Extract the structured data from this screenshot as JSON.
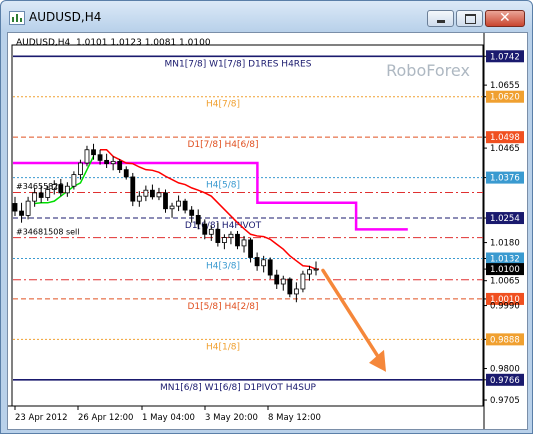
{
  "window": {
    "title": "AUDUSD,H4",
    "controls": {
      "minimize": "minimize",
      "maximize": "maximize",
      "close": "close"
    }
  },
  "header": {
    "symbol": "AUDUSD,H4",
    "ohlc": "1.0101 1.0123 1.0081 1.0100"
  },
  "watermark": "RoboForex",
  "colors": {
    "background": "#ffffff",
    "candles": "#000000",
    "trail_red": "#ff0000",
    "trail_green": "#00dd00",
    "magenta": "#ff00ff",
    "arrow": "#f5873a",
    "current_price_box": "#000000"
  },
  "chart_data": {
    "type": "candlestick",
    "x_tick_labels": [
      "23 Apr 2012",
      "26 Apr 12:00",
      "1 May 04:00",
      "3 May 20:00",
      "8 May 12:00"
    ],
    "y_range": [
      0.969,
      1.077
    ],
    "y_ticks": [
      {
        "value": 1.0742,
        "label": "1.0742",
        "style": "boxed-navy"
      },
      {
        "value": 1.0655,
        "label": "1.0655",
        "style": "plain"
      },
      {
        "value": 1.062,
        "label": "1.0620",
        "style": "boxed-orange"
      },
      {
        "value": 1.0498,
        "label": "1.0498",
        "style": "boxed-red"
      },
      {
        "value": 1.0465,
        "label": "1.0465",
        "style": "plain"
      },
      {
        "value": 1.0376,
        "label": "1.0376",
        "style": "boxed-blue"
      },
      {
        "value": 1.0254,
        "label": "1.0254",
        "style": "boxed-navy"
      },
      {
        "value": 1.018,
        "label": "1.0180",
        "style": "plain"
      },
      {
        "value": 1.0132,
        "label": "1.0132",
        "style": "boxed-blue"
      },
      {
        "value": 1.01,
        "label": "1.0100",
        "style": "boxed-black"
      },
      {
        "value": 1.0065,
        "label": "1.0065",
        "style": "plain"
      },
      {
        "value": 1.001,
        "label": "1.0010",
        "style": "boxed-red"
      },
      {
        "value": 0.999,
        "label": "0.9990",
        "style": "plain"
      },
      {
        "value": 0.9888,
        "label": "0.9888",
        "style": "boxed-orange"
      },
      {
        "value": 0.98,
        "label": "0.9800",
        "style": "plain"
      },
      {
        "value": 0.9766,
        "label": "0.9766",
        "style": "boxed-navy"
      },
      {
        "value": 0.9705,
        "label": "0.9705",
        "style": "plain"
      }
    ],
    "levels": [
      {
        "value": 1.0742,
        "label": "MN1[7/8] W1[7/8] D1RES H4RES",
        "color": "#1a1a6e",
        "style": "solid-thick",
        "label_pos": "center"
      },
      {
        "value": 1.062,
        "label": "H4[7/8]",
        "color": "#f0a030",
        "style": "dot",
        "label_pos": "center"
      },
      {
        "value": 1.0498,
        "label": "D1[7/8] H4[6/8]",
        "color": "#e05020",
        "style": "dash",
        "label_pos": "center"
      },
      {
        "value": 1.0376,
        "label": "H4[5/8]",
        "color": "#3a9ad0",
        "style": "dot",
        "label_pos": "center"
      },
      {
        "value": 1.0254,
        "label": "D1[6/8] H4PIVOT",
        "color": "#1a1a6e",
        "style": "dash",
        "label_pos": "center"
      },
      {
        "value": 1.0132,
        "label": "H4[3/8]",
        "color": "#3a9ad0",
        "style": "dot",
        "label_pos": "center"
      },
      {
        "value": 1.001,
        "label": "D1[5/8] H4[2/8]",
        "color": "#e05020",
        "style": "dash",
        "label_pos": "center"
      },
      {
        "value": 0.9888,
        "label": "H4[1/8]",
        "color": "#f0a030",
        "style": "dot",
        "label_pos": "center"
      },
      {
        "value": 0.9766,
        "label": "MN1[6/8] W1[6/8] D1PIVOT H4SUP",
        "color": "#1a1a6e",
        "style": "solid-thick",
        "label_pos": "center"
      }
    ],
    "extra_lines": [
      {
        "value": 1.0331,
        "color": "#e03030",
        "style": "dashdot"
      },
      {
        "value": 1.0195,
        "color": "#e03030",
        "style": "dashdot"
      },
      {
        "value": 1.0068,
        "color": "#e03030",
        "style": "dashdot"
      }
    ],
    "order_labels": [
      {
        "text": "#34655826",
        "price": 1.035,
        "bar": 0
      },
      {
        "text": "#34681508 sell",
        "price": 1.0214,
        "bar": 0
      }
    ],
    "candles": [
      [
        1.0298,
        1.0318,
        1.026,
        1.0275
      ],
      [
        1.0275,
        1.03,
        1.024,
        1.0262
      ],
      [
        1.0262,
        1.0318,
        1.025,
        1.0305
      ],
      [
        1.0305,
        1.0345,
        1.0288,
        1.033
      ],
      [
        1.033,
        1.035,
        1.03,
        1.0316
      ],
      [
        1.0316,
        1.0352,
        1.0306,
        1.034
      ],
      [
        1.034,
        1.0368,
        1.0325,
        1.0355
      ],
      [
        1.0355,
        1.0372,
        1.032,
        1.033
      ],
      [
        1.033,
        1.0362,
        1.0318,
        1.035
      ],
      [
        1.035,
        1.0395,
        1.034,
        1.0385
      ],
      [
        1.0385,
        1.043,
        1.037,
        1.042
      ],
      [
        1.042,
        1.0472,
        1.041,
        1.046
      ],
      [
        1.046,
        1.0478,
        1.043,
        1.0445
      ],
      [
        1.0445,
        1.046,
        1.0415,
        1.0428
      ],
      [
        1.0428,
        1.0448,
        1.0405,
        1.0418
      ],
      [
        1.0418,
        1.044,
        1.0398,
        1.0425
      ],
      [
        1.0425,
        1.0432,
        1.039,
        1.04
      ],
      [
        1.04,
        1.041,
        1.037,
        1.0378
      ],
      [
        1.0378,
        1.039,
        1.029,
        1.0305
      ],
      [
        1.0305,
        1.0335,
        1.0288,
        1.032
      ],
      [
        1.032,
        1.0352,
        1.0305,
        1.0338
      ],
      [
        1.0338,
        1.0355,
        1.031,
        1.0318
      ],
      [
        1.0318,
        1.0345,
        1.0308,
        1.033
      ],
      [
        1.033,
        1.034,
        1.027,
        1.0282
      ],
      [
        1.0282,
        1.03,
        1.0255,
        1.029
      ],
      [
        1.029,
        1.0322,
        1.0275,
        1.0305
      ],
      [
        1.0305,
        1.0312,
        1.0268,
        1.0278
      ],
      [
        1.0278,
        1.029,
        1.024,
        1.0262
      ],
      [
        1.0262,
        1.028,
        1.022,
        1.0236
      ],
      [
        1.0236,
        1.025,
        1.019,
        1.0205
      ],
      [
        1.0205,
        1.0232,
        1.0185,
        1.022
      ],
      [
        1.022,
        1.024,
        1.0168,
        1.018
      ],
      [
        1.018,
        1.0205,
        1.016,
        1.0195
      ],
      [
        1.0195,
        1.0214,
        1.0175,
        1.0205
      ],
      [
        1.0205,
        1.0215,
        1.016,
        1.017
      ],
      [
        1.017,
        1.02,
        1.015,
        1.0188
      ],
      [
        1.0188,
        1.0195,
        1.012,
        1.0135
      ],
      [
        1.0135,
        1.015,
        1.0095,
        1.011
      ],
      [
        1.011,
        1.014,
        1.009,
        1.0128
      ],
      [
        1.0128,
        1.0135,
        1.007,
        1.0082
      ],
      [
        1.0082,
        1.0098,
        1.004,
        1.0055
      ],
      [
        1.0055,
        1.008,
        1.0035,
        1.007
      ],
      [
        1.007,
        1.0075,
        1.0015,
        1.0025
      ],
      [
        1.0025,
        1.006,
        1.0,
        1.004
      ],
      [
        1.004,
        1.0095,
        1.003,
        1.0085
      ],
      [
        1.0085,
        1.011,
        1.0065,
        1.0098
      ],
      [
        1.0098,
        1.0123,
        1.0081,
        1.01
      ]
    ],
    "trail_red": [
      1.046,
      1.046,
      1.044,
      1.043,
      1.042,
      1.0418,
      1.0408,
      1.04,
      1.0398,
      1.0392,
      1.038,
      1.037,
      1.036,
      1.0355,
      1.0345,
      1.0338,
      1.033,
      1.032,
      1.03,
      1.028,
      1.026,
      1.024,
      1.0222,
      1.0205,
      1.02,
      1.0198,
      1.019,
      1.0175,
      1.016,
      1.014,
      1.0125,
      1.011,
      1.0108,
      1.01
    ],
    "trail_green": [
      1.0298,
      1.03,
      1.03,
      1.0305,
      1.032,
      1.0335,
      1.035,
      1.036,
      1.04,
      1.044
    ],
    "magenta_steps": [
      {
        "from": 0.0,
        "to": 0.38,
        "value": 1.042
      },
      {
        "from": 0.38,
        "to": 0.52,
        "value": 1.042
      },
      {
        "from": 0.52,
        "to": 0.73,
        "value": 1.03
      },
      {
        "from": 0.73,
        "to": 0.84,
        "value": 1.022
      }
    ],
    "current_price": 1.01,
    "forecast_arrow": {
      "from_price": 1.009,
      "to_price": 0.9775
    }
  }
}
